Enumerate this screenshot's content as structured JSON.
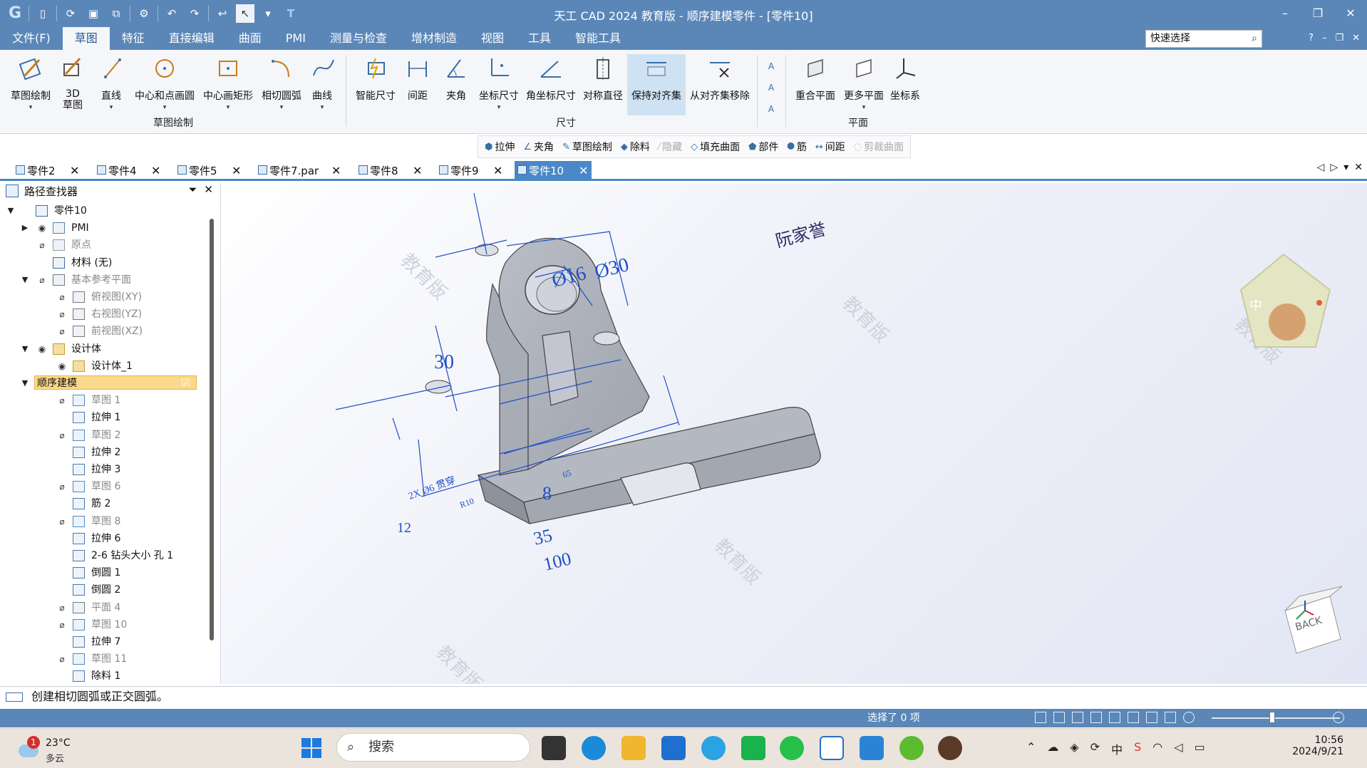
{
  "window": {
    "title": "天工 CAD 2024 教育版 - 顺序建模零件 - [零件10]"
  },
  "menu": {
    "items": [
      "文件(F)",
      "草图",
      "特征",
      "直接编辑",
      "曲面",
      "PMI",
      "测量与检查",
      "增材制造",
      "视图",
      "工具",
      "智能工具"
    ],
    "active": "草图",
    "quick_search": "快速选择",
    "help": "?"
  },
  "ribbon": {
    "sketch_group": "草图绘制",
    "dimension_group": "尺寸",
    "plane_group": "平面",
    "buttons": {
      "sketch": "草图绘制",
      "sketch3d": "3D 草图",
      "line": "直线",
      "center_circle": "中心和点画圆",
      "center_rect": "中心画矩形",
      "tangent_arc": "相切圆弧",
      "curve": "曲线",
      "smart_dim": "智能尺寸",
      "distance": "间距",
      "angle": "夹角",
      "coord_dim": "坐标尺寸",
      "angle_coord_dim": "角坐标尺寸",
      "sym_dia": "对称直径",
      "keep_align": "保持对齐集",
      "remove_align": "从对齐集移除",
      "coincident_plane": "重合平面",
      "more_planes": "更多平面",
      "coord_sys": "坐标系"
    }
  },
  "feature_toolbar": [
    {
      "label": "拉伸",
      "enabled": true
    },
    {
      "label": "夹角",
      "enabled": true
    },
    {
      "label": "草图绘制",
      "enabled": true
    },
    {
      "label": "除料",
      "enabled": true
    },
    {
      "label": "隐藏",
      "enabled": false
    },
    {
      "label": "填充曲面",
      "enabled": true
    },
    {
      "label": "部件",
      "enabled": true
    },
    {
      "label": "筋",
      "enabled": true
    },
    {
      "label": "间距",
      "enabled": true
    },
    {
      "label": "剪裁曲面",
      "enabled": false
    }
  ],
  "doc_tabs": [
    "零件2",
    "零件4",
    "零件5",
    "零件7.par",
    "零件8",
    "零件9",
    "零件10"
  ],
  "active_tab": "零件10",
  "pathfinder": {
    "title": "路径查找器",
    "nodes": [
      {
        "label": "零件10"
      },
      {
        "label": "PMI"
      },
      {
        "label": "原点"
      },
      {
        "label": "材料 (无)"
      },
      {
        "label": "基本参考平面"
      },
      {
        "label": "俯视图(XY)"
      },
      {
        "label": "右视图(YZ)"
      },
      {
        "label": "前视图(XZ)"
      },
      {
        "label": "设计体"
      },
      {
        "label": "设计体_1"
      },
      {
        "label": "顺序建模"
      },
      {
        "label": "草图 1"
      },
      {
        "label": "拉伸 1"
      },
      {
        "label": "草图 2"
      },
      {
        "label": "拉伸 2"
      },
      {
        "label": "拉伸 3"
      },
      {
        "label": "草图 6"
      },
      {
        "label": "筋 2"
      },
      {
        "label": "草图 8"
      },
      {
        "label": "拉伸 6"
      },
      {
        "label": "2-6 钻头大小 孔 1"
      },
      {
        "label": "倒圆 1"
      },
      {
        "label": "倒圆 2"
      },
      {
        "label": "平面 4"
      },
      {
        "label": "草图 10"
      },
      {
        "label": "拉伸 7"
      },
      {
        "label": "草图 11"
      },
      {
        "label": "除料 1"
      }
    ]
  },
  "viewport": {
    "author_text": "阮家誉",
    "watermark": "教育版",
    "view_cube": "BACK",
    "badge_text": "中",
    "dims": {
      "d16": "Ø16",
      "d30": "Ø30",
      "h30": "30",
      "w8": "8",
      "w35": "35",
      "w100": "100",
      "h12": "12",
      "hole_note": "2X Ø6 贯穿",
      "r10": "R10",
      "r65": "65"
    }
  },
  "command_line": "创建相切圆弧或正交圆弧。",
  "status": {
    "selection": "选择了 0 项",
    "zoom_fraction": 0.47
  },
  "taskbar": {
    "weather_temp": "23°C",
    "weather_desc": "多云",
    "weather_badge": "1",
    "search_placeholder": "搜索",
    "time": "10:56",
    "date": "2024/9/21"
  }
}
